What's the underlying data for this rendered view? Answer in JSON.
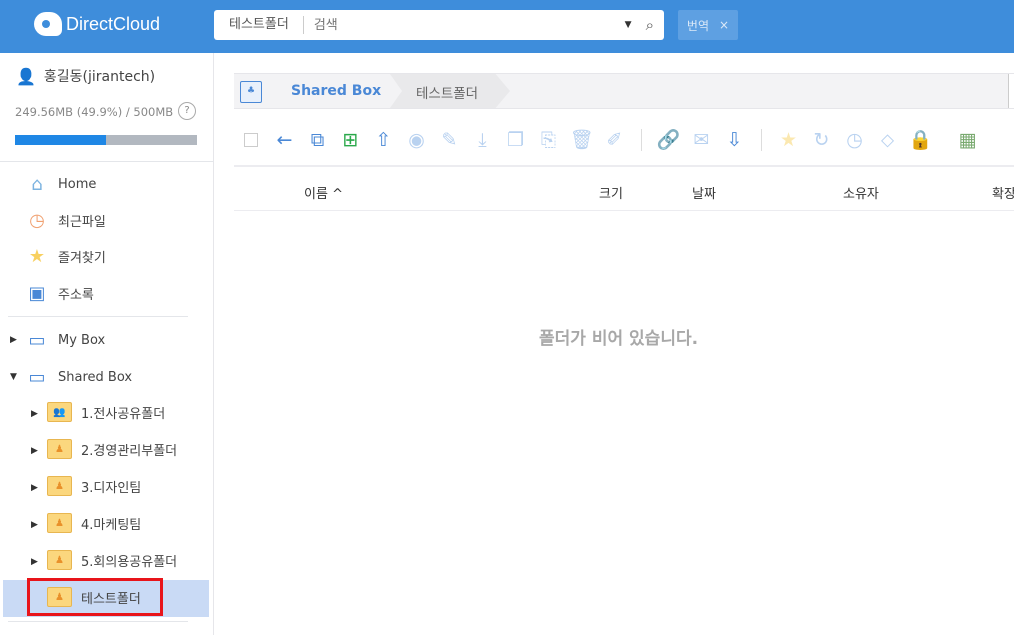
{
  "header": {
    "logo": "DirectCloud",
    "search_folder": "테스트폴더",
    "search_placeholder": "검색",
    "translate_label": "번역",
    "translate_close": "×"
  },
  "sidebar": {
    "user": "홍길동(jirantech)",
    "quota_text": "249.56MB (49.9%) / 500MB",
    "quota_percent": 49.9,
    "help": "?",
    "nav": [
      {
        "label": "Home",
        "icon": "home-icon"
      },
      {
        "label": "최근파일",
        "icon": "clock-icon"
      },
      {
        "label": "즐겨찾기",
        "icon": "star-icon"
      },
      {
        "label": "주소록",
        "icon": "address-book-icon"
      }
    ],
    "boxes": [
      {
        "label": "My Box",
        "expanded": false
      },
      {
        "label": "Shared Box",
        "expanded": true
      }
    ],
    "folders": [
      "1.전사공유폴더",
      "2.경영관리부폴더",
      "3.디자인팀",
      "4.마케팅팀",
      "5.회의용공유폴더",
      "테스트폴더"
    ],
    "selected": "테스트폴더"
  },
  "breadcrumb": [
    "Shared Box",
    "테스트폴더"
  ],
  "table": {
    "columns": [
      "이름",
      "크기",
      "날짜",
      "소유자",
      "확장"
    ],
    "sort_indicator": "^",
    "empty_message": "폴더가 비어 있습니다."
  }
}
